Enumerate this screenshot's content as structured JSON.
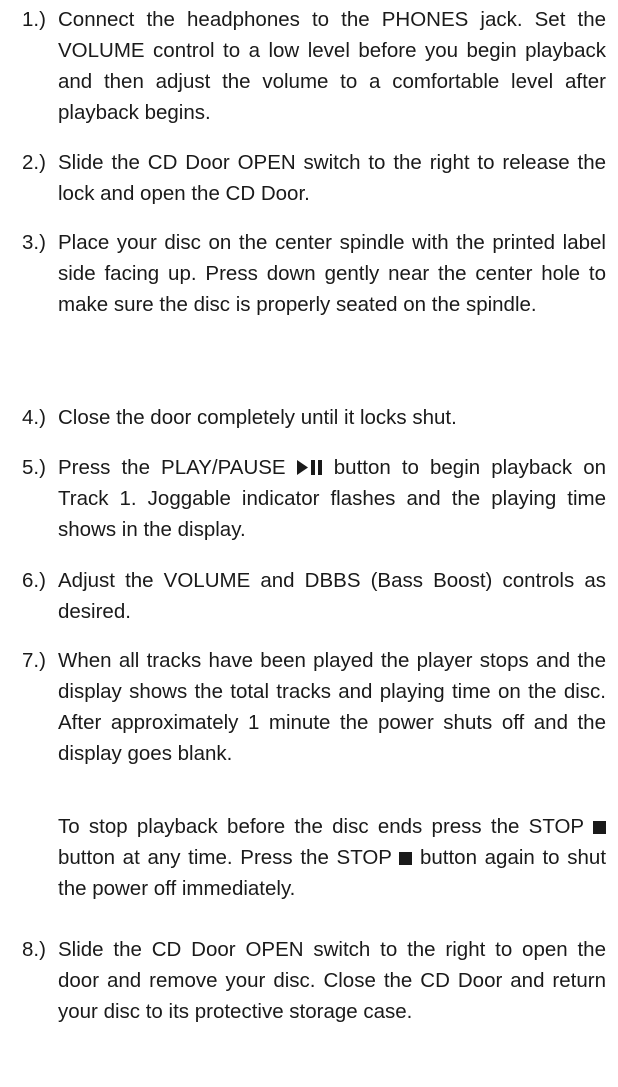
{
  "steps": [
    {
      "number": "1.)",
      "text": "Connect the headphones to the PHONES jack. Set the VOLUME control to a low level before you begin playback and then adjust the volume to a comfortable level after playback begins."
    },
    {
      "number": "2.)",
      "text": "Slide the CD Door OPEN switch to the right to release the lock and open the CD Door."
    },
    {
      "number": "3.)",
      "text": "Place your disc on the center spindle with the printed label side facing up. Press down gently near the center hole to make sure the disc is properly seated on the spindle."
    },
    {
      "number": "4.)",
      "text": "Close the door completely until it locks shut."
    },
    {
      "number": "5.)",
      "text_before_icon": "Press the PLAY/PAUSE",
      "icon": "play-pause-icon",
      "text_after_icon": "button to begin playback on Track 1. Joggable indicator flashes and the playing time shows in the display."
    },
    {
      "number": "6.)",
      "text": "Adjust the VOLUME and DBBS (Bass Boost) controls as desired."
    },
    {
      "number": "7.)",
      "text": "When all tracks have been played the player stops and the display shows the total tracks and playing time on the disc. After approximately 1 minute the power shuts off and the display goes blank.",
      "note_part1": "To stop playback before the disc ends press the STOP",
      "note_icon1": "stop-icon",
      "note_part2": "button at any time. Press the STOP",
      "note_icon2": "stop-icon",
      "note_part3": "button again to shut the power off immediately."
    },
    {
      "number": "8.)",
      "text": "Slide the CD Door OPEN switch to the right to open the door and remove your disc. Close the CD Door and return your disc to its protective storage case."
    }
  ],
  "colors": {
    "text": "#1a1a1a",
    "background": "#ffffff"
  }
}
